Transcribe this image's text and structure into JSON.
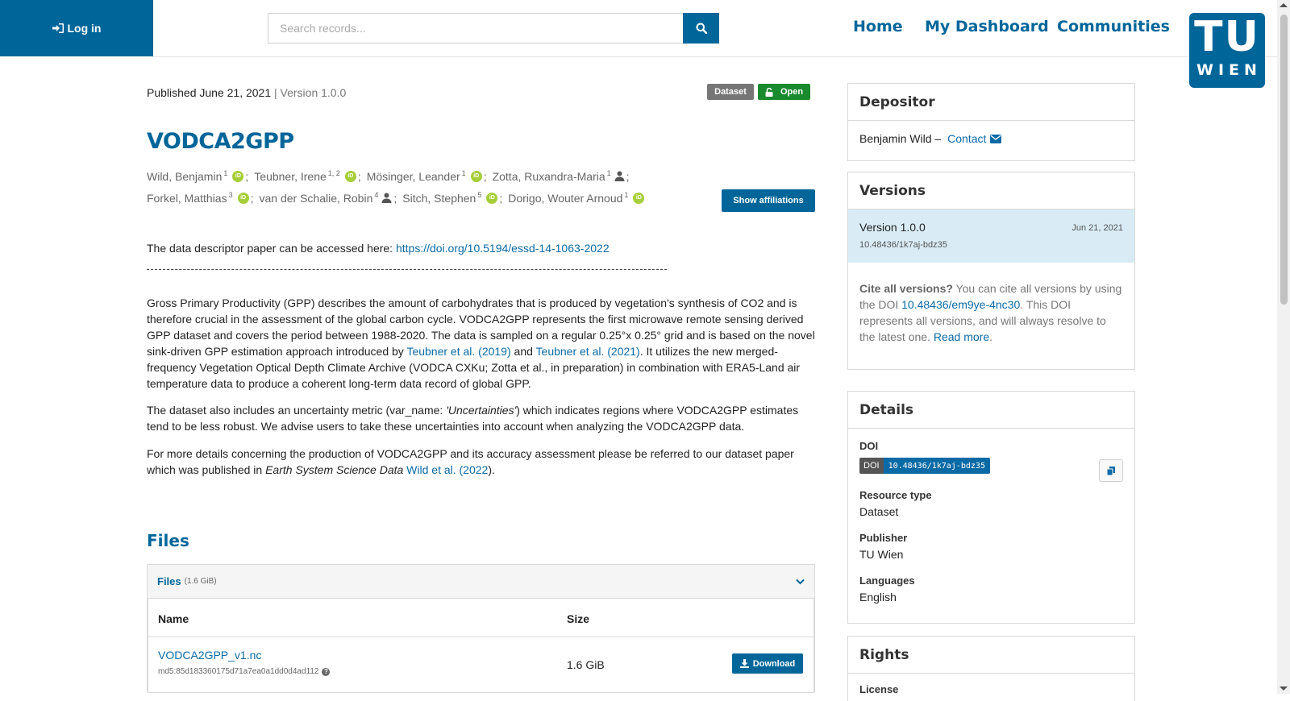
{
  "header": {
    "login_label": "Log in",
    "search_placeholder": "Search records...",
    "nav": [
      "Home",
      "My Dashboard",
      "Communities"
    ],
    "logo_top": "TU",
    "logo_bottom": "WIEN"
  },
  "record": {
    "published": "Published June 21, 2021",
    "version_sep": " | ",
    "version": "Version 1.0.0",
    "badge_type": "Dataset",
    "badge_access": "Open",
    "title": "VODCA2GPP",
    "authors_line1": [
      {
        "name": "Wild, Benjamin",
        "sup": "1",
        "icon": "orcid"
      },
      {
        "name": "Teubner, Irene",
        "sup": "1, 2",
        "icon": "orcid"
      },
      {
        "name": "Mösinger, Leander",
        "sup": "1",
        "icon": "orcid"
      },
      {
        "name": "Zotta, Ruxandra-Maria",
        "sup": "1",
        "icon": "person"
      }
    ],
    "authors_line2": [
      {
        "name": "Forkel, Matthias",
        "sup": "3",
        "icon": "orcid"
      },
      {
        "name": "van der Schalie, Robin",
        "sup": "4",
        "icon": "person"
      },
      {
        "name": "Sitch, Stephen",
        "sup": "5",
        "icon": "orcid"
      },
      {
        "name": "Dorigo, Wouter Arnoud",
        "sup": "1",
        "icon": "orcid"
      }
    ],
    "show_affiliations": "Show affiliations",
    "descriptor_text": "The data descriptor paper can be accessed here: ",
    "descriptor_link": "https://doi.org/10.5194/essd-14-1063-2022",
    "para1_a": "Gross Primary Productivity (GPP) describes the amount of carbohydrates that is produced by vegetation's synthesis of CO2 and is therefore crucial in the assessment of the global carbon cycle. VODCA2GPP represents the first microwave remote sensing derived GPP dataset and covers the period between 1988-2020. The data is sampled on a regular 0.25°x 0.25° grid and is based on the novel sink-driven GPP estimation approach introduced by ",
    "para1_link1": "Teubner et al. (2019)",
    "para1_b": " and ",
    "para1_link2": "Teubner et al. (2021)",
    "para1_c": ". It utilizes the new merged-frequency Vegetation Optical Depth Climate Archive (VODCA CXKu; Zotta et al., in preparation) in combination with ERA5-Land air temperature data to produce a coherent long-term data record of global GPP.",
    "para2_a": "The dataset also includes an uncertainty metric (var_name: ",
    "para2_em": "'Uncertainties'",
    "para2_b": ") which indicates regions where VODCA2GPP estimates tend to be less robust. We advise users to take these uncertainties into account when analyzing the VODCA2GPP data.",
    "para3_a": "For more details concerning the production of VODCA2GPP and its accuracy assessment please be referred to our dataset paper which was published in ",
    "para3_em": "Earth System Science Data",
    "para3_sp": " ",
    "para3_link": "Wild et al. (2022",
    "para3_b": ")."
  },
  "files": {
    "heading": "Files",
    "bar_label": "Files",
    "bar_size": "(1.6 GiB)",
    "col_name": "Name",
    "col_size": "Size",
    "file_name": "VODCA2GPP_v1.nc",
    "md5": "md5:85d183360175d71a7ea0a1dd0d4ad112",
    "file_size": "1.6 GiB",
    "download": "Download"
  },
  "sidebar": {
    "depositor_title": "Depositor",
    "depositor_name": "Benjamin Wild –",
    "contact": "Contact",
    "versions_title": "Versions",
    "version_label": "Version 1.0.0",
    "version_date": "Jun 21, 2021",
    "version_doi": "10.48436/1k7aj-bdz35",
    "cite_bold": "Cite all versions?",
    "cite_a": " You can cite all versions by using the DOI ",
    "cite_link": "10.48436/em9ye-4nc30",
    "cite_b": ". This DOI represents all versions, and will always resolve to the latest one. ",
    "read_more": "Read more",
    "read_more_end": ".",
    "details_title": "Details",
    "doi_label": "DOI",
    "doi_key": "DOI",
    "doi_value": "10.48436/1k7aj-bdz35",
    "resource_label": "Resource type",
    "resource_value": "Dataset",
    "publisher_label": "Publisher",
    "publisher_value": "TU Wien",
    "languages_label": "Languages",
    "languages_value": "English",
    "rights_title": "Rights",
    "license_label": "License"
  },
  "colors": {
    "brand": "#006699",
    "link": "#0a6aa6",
    "open_badge": "#1a8a2e",
    "orcid": "#a6ce39"
  }
}
